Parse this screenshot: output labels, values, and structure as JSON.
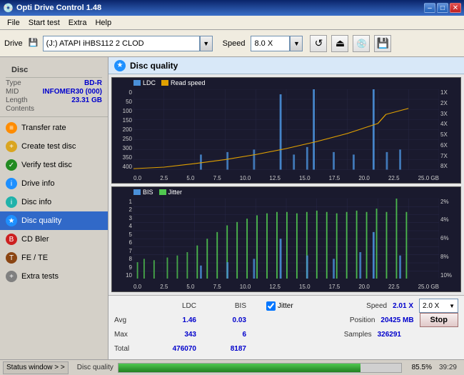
{
  "titlebar": {
    "title": "Opti Drive Control 1.48",
    "min_label": "–",
    "max_label": "□",
    "close_label": "✕"
  },
  "menubar": {
    "items": [
      "File",
      "Start test",
      "Extra",
      "Help"
    ]
  },
  "toolbar": {
    "drive_label": "Drive",
    "drive_value": "(J:) ATAPI iHBS112 2 CLOD",
    "speed_label": "Speed",
    "speed_value": "8.0 X"
  },
  "sidebar": {
    "disc_section_title": "Disc",
    "disc_type_label": "Type",
    "disc_type_value": "BD-R",
    "disc_mid_label": "MID",
    "disc_mid_value": "INFOMER30 (000)",
    "disc_length_label": "Length",
    "disc_length_value": "23.31 GB",
    "disc_contents_label": "Contents",
    "disc_contents_value": "",
    "items": [
      {
        "id": "transfer-rate",
        "label": "Transfer rate",
        "icon": "≡",
        "icon_class": "orange"
      },
      {
        "id": "create-test-disc",
        "label": "Create test disc",
        "icon": "+",
        "icon_class": "yellow"
      },
      {
        "id": "verify-test-disc",
        "label": "Verify test disc",
        "icon": "✓",
        "icon_class": "green"
      },
      {
        "id": "drive-info",
        "label": "Drive info",
        "icon": "i",
        "icon_class": "blue"
      },
      {
        "id": "disc-info",
        "label": "Disc info",
        "icon": "i",
        "icon_class": "teal"
      },
      {
        "id": "disc-quality",
        "label": "Disc quality",
        "icon": "★",
        "icon_class": "blue",
        "active": true
      },
      {
        "id": "cd-bler",
        "label": "CD Bler",
        "icon": "B",
        "icon_class": "red"
      },
      {
        "id": "fe-te",
        "label": "FE / TE",
        "icon": "T",
        "icon_class": "purple"
      },
      {
        "id": "extra-tests",
        "label": "Extra tests",
        "icon": "+",
        "icon_class": "gray"
      }
    ]
  },
  "content": {
    "header_title": "Disc quality",
    "chart1": {
      "title": "",
      "legend_ldc": "LDC",
      "legend_read": "Read speed",
      "y_left_labels": [
        "0",
        "50",
        "100",
        "150",
        "200",
        "250",
        "300",
        "350",
        "400"
      ],
      "y_right_labels": [
        "1X",
        "2X",
        "3X",
        "4X",
        "5X",
        "6X",
        "7X",
        "8X"
      ],
      "x_labels": [
        "0.0",
        "2.5",
        "5.0",
        "7.5",
        "10.0",
        "12.5",
        "15.0",
        "17.5",
        "20.0",
        "22.5",
        "25.0 GB"
      ]
    },
    "chart2": {
      "legend_bis": "BIS",
      "legend_jitter": "Jitter",
      "y_left_labels": [
        "1",
        "2",
        "3",
        "4",
        "5",
        "6",
        "7",
        "8",
        "9",
        "10"
      ],
      "y_right_labels": [
        "2%",
        "4%",
        "6%",
        "8%",
        "10%"
      ],
      "x_labels": [
        "0.0",
        "2.5",
        "5.0",
        "7.5",
        "10.0",
        "12.5",
        "15.0",
        "17.5",
        "20.0",
        "22.5",
        "25.0 GB"
      ]
    },
    "stats": {
      "col_ldc": "LDC",
      "col_bis": "BIS",
      "jitter_label": "Jitter",
      "speed_label": "Speed",
      "speed_value": "2.01 X",
      "speed_box_value": "2.0 X",
      "avg_label": "Avg",
      "avg_ldc": "1.46",
      "avg_bis": "0.03",
      "position_label": "Position",
      "position_value": "20425 MB",
      "max_label": "Max",
      "max_ldc": "343",
      "max_bis": "6",
      "samples_label": "Samples",
      "samples_value": "326291",
      "total_label": "Total",
      "total_ldc": "476070",
      "total_bis": "8187",
      "stop_label": "Stop"
    }
  },
  "statusbar": {
    "status_window_label": "Status window > >",
    "disc_quality_label": "Disc quality",
    "progress_pct": "85.5%",
    "time": "39:29",
    "progress_value": 85.5
  }
}
